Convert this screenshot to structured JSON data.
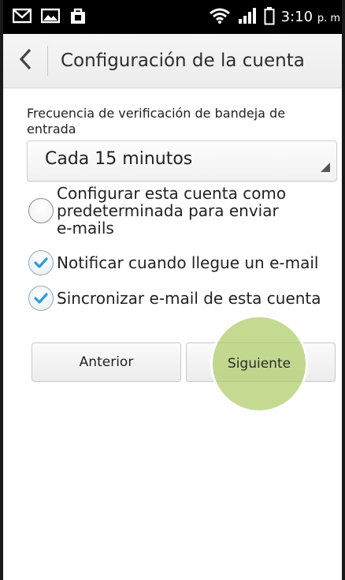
{
  "status_bar": {
    "time": "3:10",
    "ampm": "p. m",
    "icons": [
      "gmail-icon",
      "image-icon",
      "bag-icon",
      "wifi-icon",
      "signal-icon",
      "battery-icon"
    ]
  },
  "header": {
    "back_icon": "chevron-left-icon",
    "title": "Configuración de la cuenta"
  },
  "form": {
    "frequency_label": "Frecuencia de verificación de bandeja de entrada",
    "frequency_value": "Cada 15 minutos",
    "options": [
      {
        "label": "Configurar esta cuenta como predeterminada para enviar e-mails",
        "checked": false
      },
      {
        "label": "Notificar cuando llegue un e-mail",
        "checked": true
      },
      {
        "label": "Sincronizar e-mail de esta cuenta",
        "checked": true
      }
    ]
  },
  "buttons": {
    "previous": "Anterior",
    "next": "Siguiente"
  },
  "colors": {
    "check_accent": "#2e9bd6",
    "highlight": "#b1cd6c"
  }
}
